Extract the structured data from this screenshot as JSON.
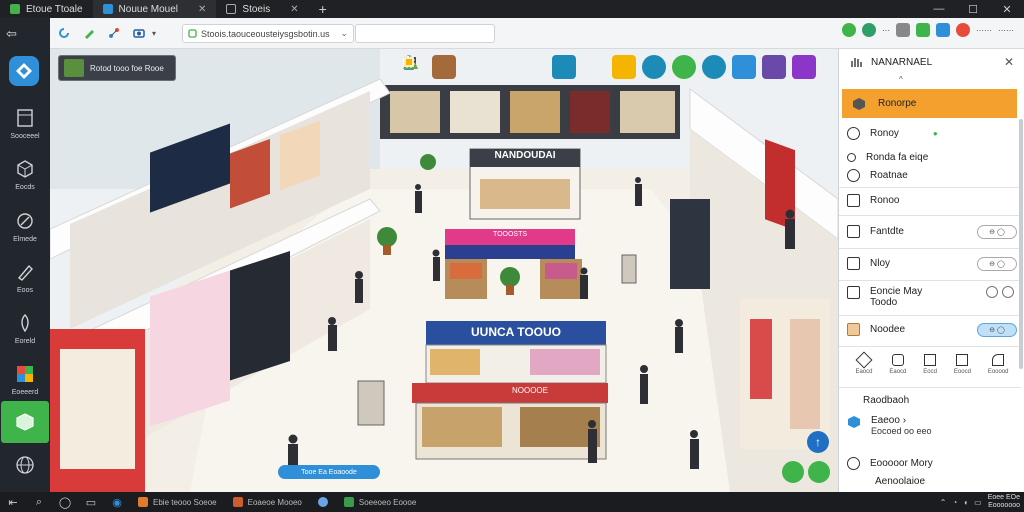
{
  "browser": {
    "tabs": [
      {
        "label": "Etoue Ttoale",
        "color": "#46b04a"
      },
      {
        "label": "Nouue Mouel",
        "color": "#2f8fd8"
      },
      {
        "label": "Stoeis",
        "color": "#888888"
      }
    ],
    "new_tab_label": "+",
    "url": "Stoois.taouceousteiysgsbotin.us",
    "window_controls": [
      "—",
      "☐",
      "✕"
    ]
  },
  "toolbar_right": {
    "text_1": "⋯",
    "text_2": "⋯⋯"
  },
  "rail": {
    "back_label": "⇦",
    "items": [
      {
        "label": "Sooceeel",
        "icon": "layers-icon"
      },
      {
        "label": "Eocds",
        "icon": "cube-icon"
      },
      {
        "label": "Elmede",
        "icon": "tools-icon"
      },
      {
        "label": "Eoos",
        "icon": "pen-icon"
      },
      {
        "label": "Eoreld",
        "icon": "brush-icon"
      },
      {
        "label": "Eoeeerd",
        "icon": "blocks-icon"
      },
      {
        "label": "",
        "icon": "box-icon"
      },
      {
        "label": "",
        "icon": "globe-icon"
      }
    ]
  },
  "viewport": {
    "scene_label": "Rotod tooo foe Rooe",
    "signs": {
      "kiosk_top": "NANDOUDAI",
      "kiosk_mid": "UUNCA TOOUO",
      "kiosk_front": "NOOOOE",
      "counter": "TOOOSTS"
    },
    "floor_tag": "Tooe Ea Eoaoode",
    "fab_up": "↑"
  },
  "panel": {
    "title": "NANARNAEL",
    "close": "✕",
    "caret": "^",
    "selected": "Ronorpe",
    "rows": [
      {
        "label": "Ronoy"
      },
      {
        "label": "Ronda fa eiqe"
      },
      {
        "label": "Roatnae"
      },
      {
        "label": "Ronoo"
      },
      {
        "label": "Fantdte",
        "toggle": "⊖ ◯"
      },
      {
        "label": "Nloy",
        "toggle": "⊖ ◯"
      },
      {
        "label": "Eoncie May\nToodo",
        "toggle": ""
      },
      {
        "label": "Noodee",
        "toggle": "⊖ ◯"
      }
    ],
    "tool_icons": [
      "Eaocd",
      "Eaocd",
      "Eocd",
      "Eoocd",
      "Eooood"
    ],
    "section_title": "Raodbaoh",
    "list": [
      {
        "title": "Eaeoo ›",
        "sub": "Eocoed oo eeo"
      },
      {
        "title": "Eooooor Mory",
        "sub": ""
      },
      {
        "title": "Aenoolaioe",
        "sub": ""
      }
    ]
  },
  "taskbar": {
    "apps": [
      {
        "label": "Ebie teooo Soeoe",
        "color": "#e07a2e"
      },
      {
        "label": "Eoaeoe Mooeo",
        "color": "#d05c2e"
      },
      {
        "label": "",
        "color": "#6aa6e6"
      },
      {
        "label": "Soeeoeo Eoooe",
        "color": "#3a9b4a"
      }
    ],
    "time": "Eoee EOe",
    "date": "Eooooooo"
  }
}
